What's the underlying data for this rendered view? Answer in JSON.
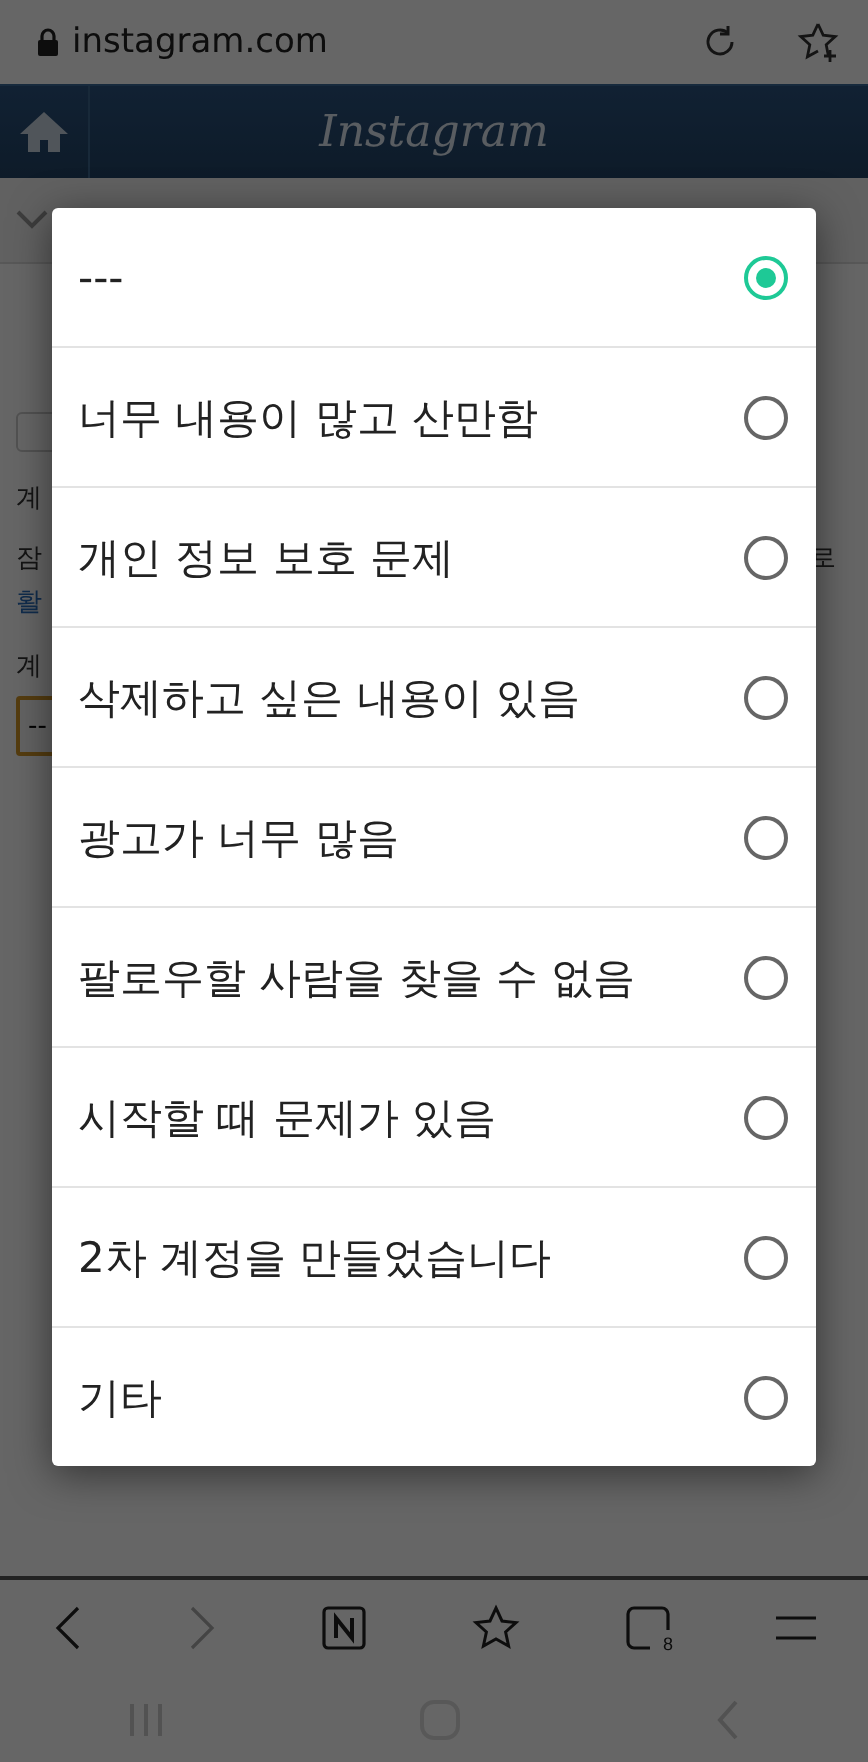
{
  "address_bar": {
    "url": "instagram.com"
  },
  "header": {
    "logo": "Instagram"
  },
  "page": {
    "label_1": "계",
    "line_start": "잠",
    "line_end": "로",
    "link": "활",
    "label_2": "계",
    "select_value": "--"
  },
  "dialog": {
    "options": [
      {
        "label": "---",
        "selected": true
      },
      {
        "label": "너무 내용이 많고 산만함",
        "selected": false
      },
      {
        "label": "개인 정보 보호 문제",
        "selected": false
      },
      {
        "label": "삭제하고 싶은 내용이 있음",
        "selected": false
      },
      {
        "label": "광고가 너무 많음",
        "selected": false
      },
      {
        "label": "팔로우할 사람을 찾을 수 없음",
        "selected": false
      },
      {
        "label": "시작할 때 문제가 있음",
        "selected": false
      },
      {
        "label": "2차 계정을 만들었습니다",
        "selected": false
      },
      {
        "label": "기타",
        "selected": false
      }
    ]
  },
  "toolbar": {
    "tab_count": "8"
  }
}
